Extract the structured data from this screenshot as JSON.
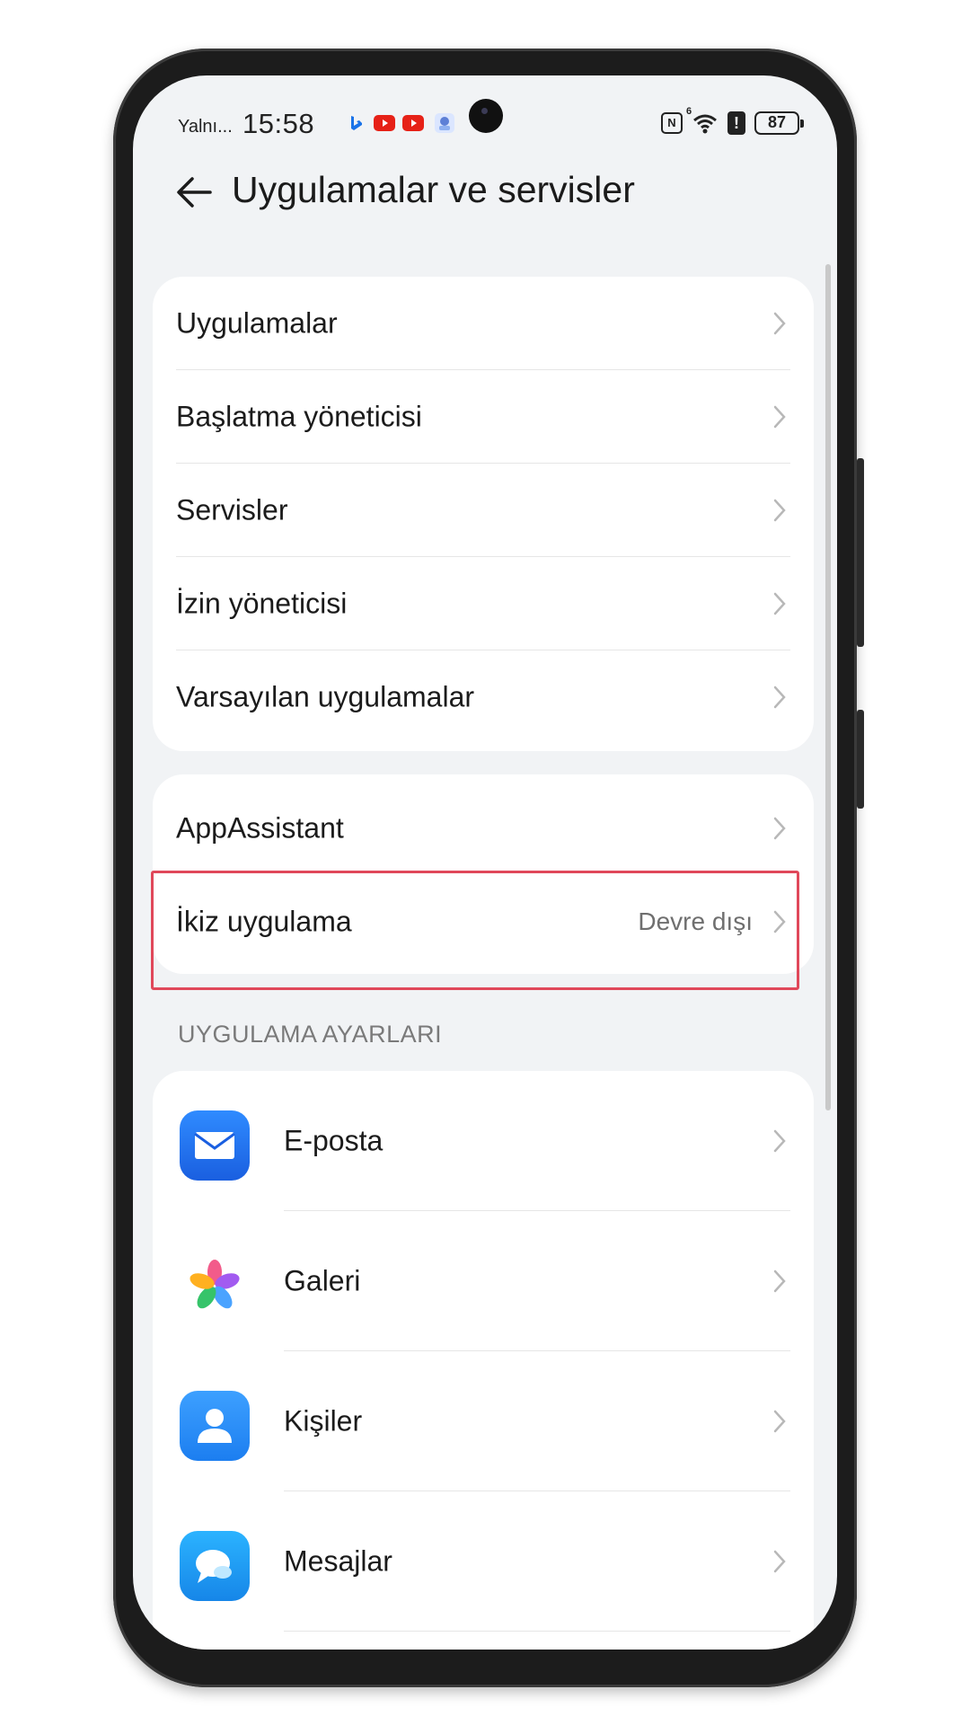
{
  "status_bar": {
    "carrier": "Yalnı...",
    "time": "15:58",
    "wifi_label": "6",
    "alert_label": "!",
    "battery": "87"
  },
  "header": {
    "title": "Uygulamalar ve servisler"
  },
  "group1": {
    "items": [
      {
        "label": "Uygulamalar"
      },
      {
        "label": "Başlatma yöneticisi"
      },
      {
        "label": "Servisler"
      },
      {
        "label": "İzin yöneticisi"
      },
      {
        "label": "Varsayılan uygulamalar"
      }
    ]
  },
  "group2": {
    "items": [
      {
        "label": "AppAssistant"
      },
      {
        "label": "İkiz uygulama",
        "value": "Devre dışı"
      }
    ]
  },
  "app_settings": {
    "section_title": "UYGULAMA AYARLARI",
    "items": [
      {
        "label": "E-posta",
        "icon": "email-icon"
      },
      {
        "label": "Galeri",
        "icon": "gallery-icon"
      },
      {
        "label": "Kişiler",
        "icon": "contacts-icon"
      },
      {
        "label": "Mesajlar",
        "icon": "messages-icon"
      }
    ]
  },
  "colors": {
    "highlight": "#e0485a",
    "background": "#f1f3f5",
    "card": "#ffffff"
  }
}
